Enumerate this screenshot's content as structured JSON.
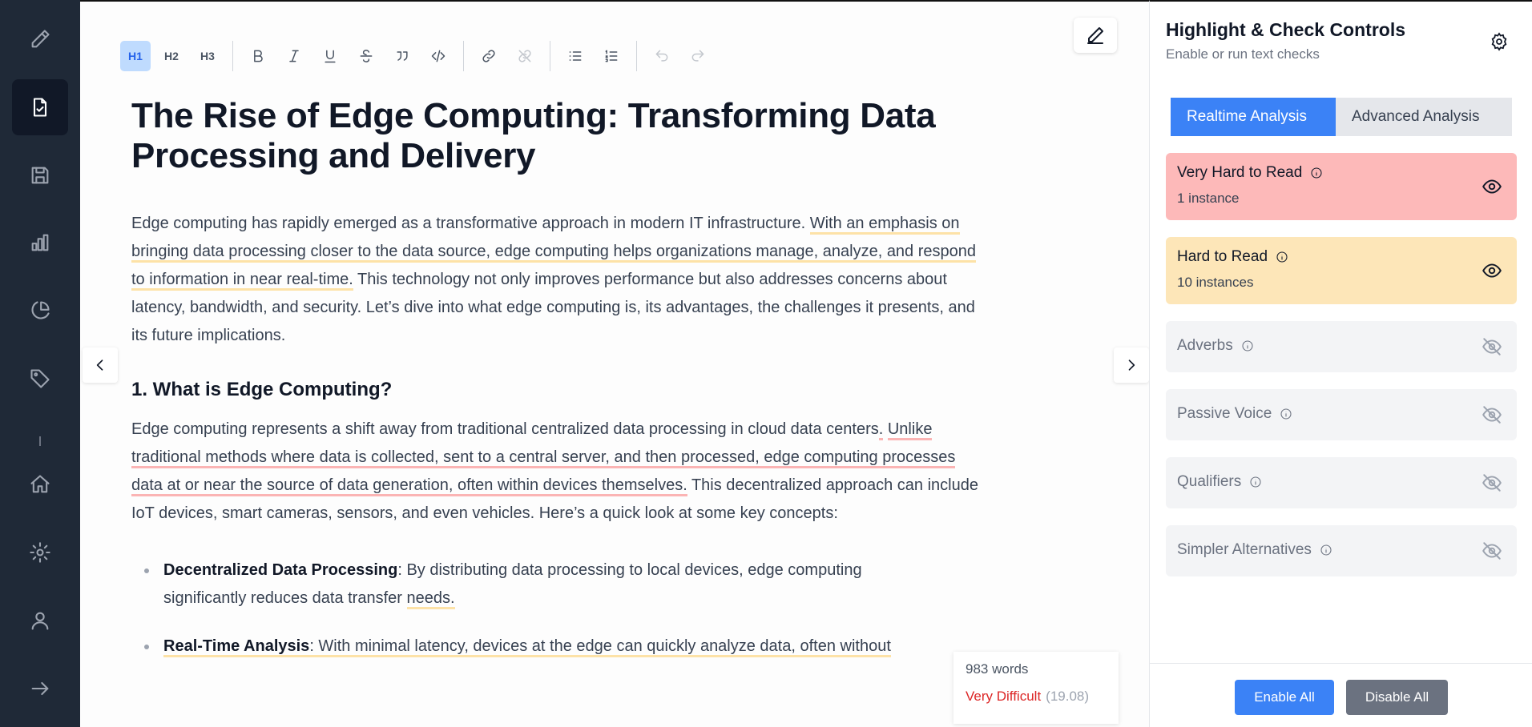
{
  "sidebar": {
    "items": [
      {
        "icon": "pencil-icon"
      },
      {
        "icon": "document-check-icon",
        "active": true
      },
      {
        "icon": "save-icon"
      },
      {
        "icon": "bar-chart-icon"
      },
      {
        "icon": "pie-chart-icon"
      },
      {
        "icon": "tag-icon"
      },
      {
        "icon": "home-icon"
      },
      {
        "icon": "gear-icon"
      },
      {
        "icon": "user-icon"
      },
      {
        "icon": "arrow-right-icon"
      }
    ]
  },
  "toolbar": {
    "h1": "H1",
    "h2": "H2",
    "h3": "H3",
    "buttons": [
      "bold-icon",
      "italic-icon",
      "underline-icon",
      "strikethrough-icon",
      "quote-icon",
      "code-icon",
      "link-icon",
      "unlink-icon",
      "bullet-list-icon",
      "numbered-list-icon",
      "undo-icon",
      "redo-icon"
    ]
  },
  "document": {
    "title": "The Rise of Edge Computing: Transforming Data Processing and Delivery",
    "p1": {
      "a": "Edge computing has rapidly emerged as a transformative approach in modern IT infrastructure. ",
      "b": "With an emphasis on bringing data processing closer to the data source, edge computing helps organizations manage, analyze, and respond to information in near real-time.",
      "c": " This technology not only improves performance but also addresses concerns about latency, bandwidth, and security. Let’s dive into what edge computing is, its advantages, the challenges it presents, and its future implications."
    },
    "h2_1": "1. What is Edge Computing?",
    "p2": {
      "a": "Edge computing represents a shift away from traditional centralized data processing in cloud data centers",
      "dot": ".",
      "b": "Unlike traditional methods where data is collected, sent to a central server, and then processed, edge computing processes data at or near the source of data generation, often within devices themselves.",
      "c": " This decentralized approach can include IoT devices, smart cameras, sensors, and even vehicles. Here’s a quick look at some key concepts:"
    },
    "bullets": [
      {
        "bold": "Decentralized Data Processing",
        "text_a": ": By distributing data processing to local devices, edge computing significantly reduces data transfer ",
        "text_hl": "needs."
      },
      {
        "bold": "Real-Time Analysis",
        "text_hl": ": With minimal latency, devices at the edge can quickly analyze data, often without"
      }
    ]
  },
  "stats": {
    "words": "983 words",
    "level": "Very Difficult",
    "score": "(19.08)"
  },
  "panel": {
    "title": "Highlight & Check Controls",
    "subtitle": "Enable or run text checks",
    "tabs": [
      "Realtime Analysis",
      "Advanced Analysis"
    ],
    "active_tab": "Realtime Analysis",
    "checks": [
      {
        "name": "Very Hard to Read",
        "count": "1 instance",
        "visible": true,
        "color": "#fdb9b9"
      },
      {
        "name": "Hard to Read",
        "count": "10 instances",
        "visible": true,
        "color": "#fde6b8"
      },
      {
        "name": "Adverbs",
        "visible": false
      },
      {
        "name": "Passive Voice",
        "visible": false
      },
      {
        "name": "Qualifiers",
        "visible": false
      },
      {
        "name": "Simpler Alternatives",
        "visible": false
      }
    ],
    "enable_all": "Enable All",
    "disable_all": "Disable All"
  },
  "colors": {
    "accent": "#3b82f6",
    "sidebar_bg": "#1f2937",
    "difficulty": "#dc2626"
  }
}
